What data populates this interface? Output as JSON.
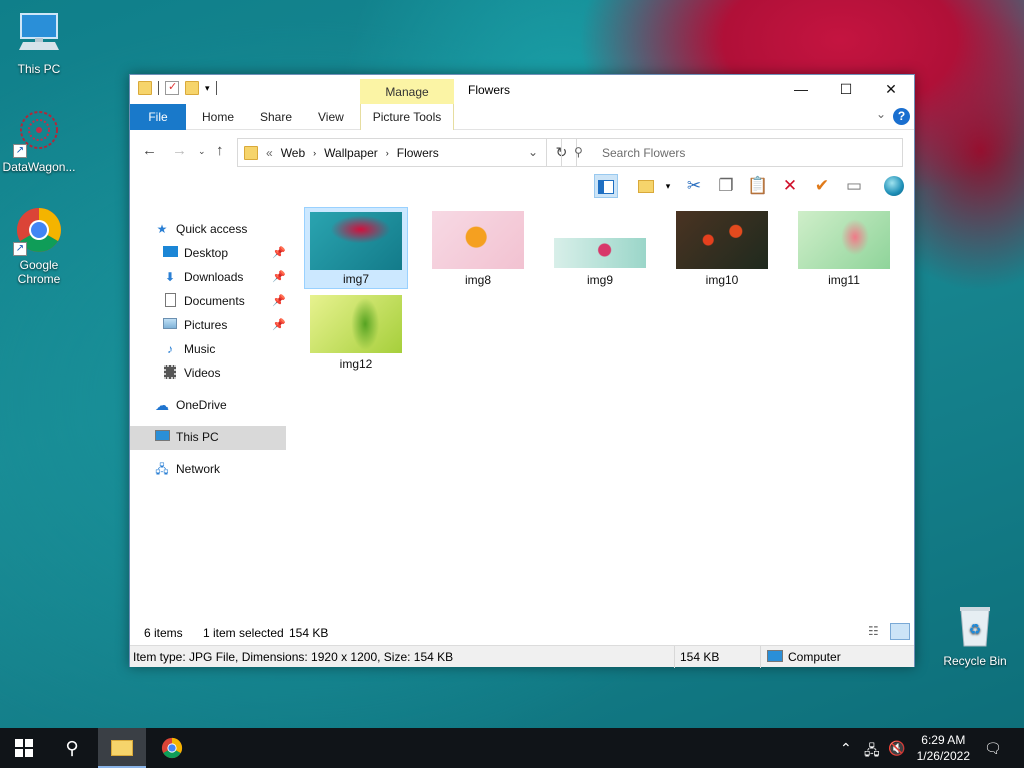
{
  "desktop": {
    "icons": [
      {
        "label": "This PC"
      },
      {
        "label": "DataWagon..."
      },
      {
        "label": "Google Chrome"
      },
      {
        "label": "Recycle Bin"
      }
    ]
  },
  "window": {
    "title": "Flowers",
    "manage_tab": "Manage",
    "picture_tools_tab": "Picture Tools",
    "ribbon_tabs": [
      "File",
      "Home",
      "Share",
      "View"
    ],
    "breadcrumb": {
      "overflow": "«",
      "items": [
        "Web",
        "Wallpaper",
        "Flowers"
      ]
    },
    "search_placeholder": "Search Flowers",
    "nav": {
      "quick_access": "Quick access",
      "desktop": "Desktop",
      "downloads": "Downloads",
      "documents": "Documents",
      "pictures": "Pictures",
      "music": "Music",
      "videos": "Videos",
      "onedrive": "OneDrive",
      "this_pc": "This PC",
      "network": "Network"
    },
    "files": [
      {
        "name": "img7",
        "selected": true
      },
      {
        "name": "img8",
        "selected": false
      },
      {
        "name": "img9",
        "selected": false
      },
      {
        "name": "img10",
        "selected": false
      },
      {
        "name": "img11",
        "selected": false
      },
      {
        "name": "img12",
        "selected": false
      }
    ],
    "status": {
      "count": "6 items",
      "selection": "1 item selected",
      "size": "154 KB"
    },
    "details": {
      "info": "Item type: JPG File, Dimensions: 1920 x 1200, Size: 154 KB",
      "size": "154 KB",
      "location": "Computer"
    }
  },
  "taskbar": {
    "time": "6:29 AM",
    "date": "1/26/2022"
  },
  "colors": {
    "accent": "#1979ca",
    "manage": "#fbf4a5",
    "selection": "#cce8ff"
  }
}
